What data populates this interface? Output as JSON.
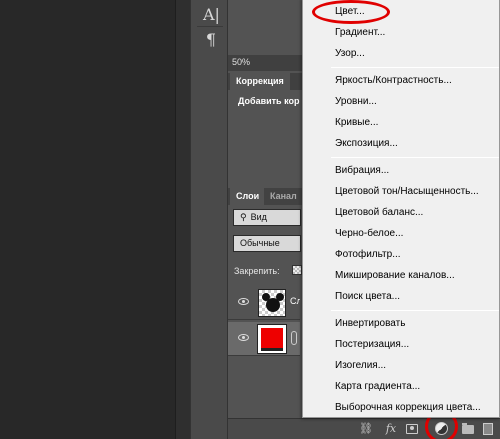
{
  "tools": [
    {
      "icon": "type-tool-icon",
      "glyph": "A|"
    },
    {
      "icon": "paragraph-icon",
      "glyph": "¶"
    }
  ],
  "zoom": "50%",
  "adjustments_panel": {
    "tabs": [
      "Коррекция"
    ],
    "add_label": "Добавить кор"
  },
  "layers_panel": {
    "tabs": [
      "Слои",
      "Канал"
    ],
    "filter_kind": "Вид",
    "blend_mode": "Обычные",
    "lock_label": "Закрепить:",
    "layers": [
      {
        "name": "Сл",
        "thumbnail": "mickey-mouse",
        "selected": false
      },
      {
        "name": "",
        "thumbnail": "red-fill",
        "selected": true
      }
    ]
  },
  "bottom_bar_icons": [
    "link-icon",
    "fx-icon",
    "layer-mask-icon",
    "adjustment-layer-icon",
    "folder-icon",
    "new-layer-icon"
  ],
  "fx_text": "fx",
  "menu": {
    "groups": [
      [
        "Цвет...",
        "Градиент...",
        "Узор..."
      ],
      [
        "Яркость/Контрастность...",
        "Уровни...",
        "Кривые...",
        "Экспозиция..."
      ],
      [
        "Вибрация...",
        "Цветовой тон/Насыщенность...",
        "Цветовой баланс...",
        "Черно-белое...",
        "Фотофильтр...",
        "Микширование каналов...",
        "Поиск цвета..."
      ],
      [
        "Инвертировать",
        "Постеризация...",
        "Изогелия...",
        "Карта градиента...",
        "Выборочная коррекция цвета..."
      ]
    ]
  },
  "highlight_color": "#e00000"
}
